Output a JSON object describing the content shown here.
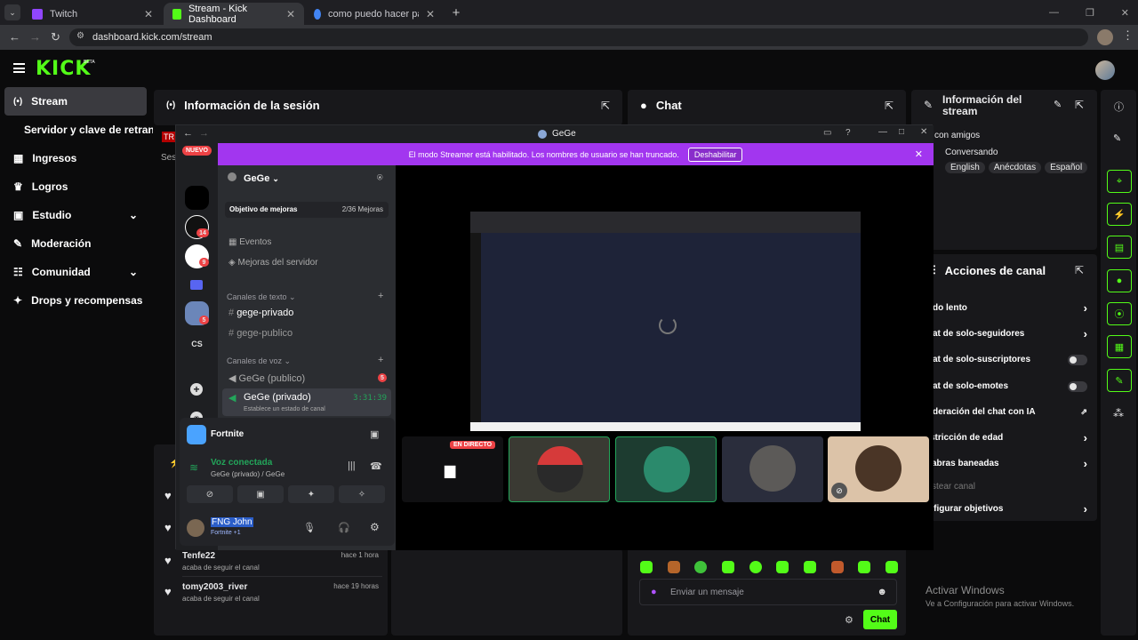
{
  "browser": {
    "tabs": [
      {
        "title": "Twitch",
        "close": "✕"
      },
      {
        "title": "Stream - Kick Dashboard",
        "close": "✕"
      },
      {
        "title": "como puedo hacer para que se",
        "close": "✕"
      }
    ],
    "new_tab": "+",
    "url": "dashboard.kick.com/stream"
  },
  "kick": {
    "logo": "KICK",
    "logo_badge": "BETA",
    "sidebar": [
      {
        "label": "Stream",
        "icon": "broadcast-icon"
      },
      {
        "label": "Servidor y clave de retransn",
        "icon": ""
      },
      {
        "label": "Ingresos",
        "icon": "chart-icon"
      },
      {
        "label": "Logros",
        "icon": "trophy-icon"
      },
      {
        "label": "Estudio",
        "icon": "studio-icon"
      },
      {
        "label": "Moderación",
        "icon": "wrench-icon"
      },
      {
        "label": "Comunidad",
        "icon": "community-icon"
      },
      {
        "label": "Drops y recompensas",
        "icon": "gift-icon"
      }
    ],
    "session_panel": {
      "title": "Información de la sesión",
      "sub": "Ses",
      "badge": "TR"
    },
    "chat_panel": {
      "title": "Chat",
      "placeholder": "Enviar un mensaje",
      "send_label": "Chat"
    },
    "stream_info": {
      "title": "Información del stream",
      "category": "con amigos",
      "subtitle": "Conversando",
      "tags": [
        "English",
        "Anécdotas",
        "Español"
      ]
    },
    "channel_actions": {
      "title": "Acciones de canal",
      "items": [
        {
          "label": "do lento",
          "control": "chevron"
        },
        {
          "label": "at de solo-seguidores",
          "control": "chevron"
        },
        {
          "label": "at de solo-suscriptores",
          "control": "toggle"
        },
        {
          "label": "at de solo-emotes",
          "control": "toggle"
        },
        {
          "label": "deración del chat con IA",
          "control": "external"
        },
        {
          "label": "stricción de edad",
          "control": "chevron"
        },
        {
          "label": "abras baneadas",
          "control": "chevron"
        },
        {
          "label": "stear canal",
          "control": "none"
        },
        {
          "label": "nfigurar objetivos",
          "control": "chevron"
        }
      ]
    },
    "activity": [
      {
        "user": "Tenfe22",
        "action": "acaba de seguir el canal",
        "time": "hace 1 hora"
      },
      {
        "user": "tomy2003_river",
        "action": "acaba de seguir el canal",
        "time": "hace 19 horas"
      }
    ],
    "windows_watermark": {
      "line1": "Activar Windows",
      "line2": "Ve a Configuración para activar Windows."
    }
  },
  "discord": {
    "window_title": "GeGe",
    "banner": {
      "text": "El modo Streamer está habilitado. Los nombres de usuario se han truncado.",
      "button": "Deshabilitar"
    },
    "new_badge": "NUEVO",
    "server_badges": [
      "14",
      "9",
      "5"
    ],
    "server_cs": "CS",
    "server_name": "GeGe",
    "goal": {
      "label": "Objetivo de mejoras",
      "progress": "2/36 Mejoras"
    },
    "menu": [
      "Eventos",
      "Mejoras del servidor"
    ],
    "text_category": "Canales de texto",
    "text_channels": [
      "gege-privado",
      "gege-publico"
    ],
    "voice_category": "Canales de voz",
    "voice_channels": [
      {
        "name": "GeGe (publico)",
        "badge": "5"
      },
      {
        "name": "GeGe (privado)",
        "timer": "3:31:39",
        "status": "Establece un estado de canal"
      }
    ],
    "activity_game": "Fortnite",
    "voice_status": {
      "title": "Voz conectada",
      "sub": "GeGe (privado) / GeGe"
    },
    "user": {
      "name": "FNG John",
      "game": "Fortnite +1"
    },
    "live_badge": "EN DIRECTO"
  },
  "colors": {
    "kick_green": "#53fc18",
    "discord_banner": "#a236ef",
    "discord_green": "#23a55a"
  }
}
